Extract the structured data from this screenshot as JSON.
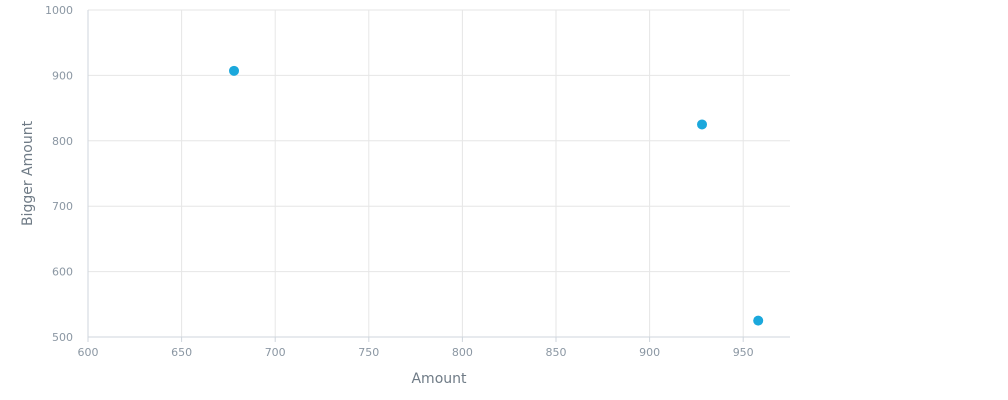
{
  "chart_data": {
    "type": "scatter",
    "title": "",
    "xlabel": "Amount",
    "ylabel": "Bigger Amount",
    "xlim": [
      600,
      975
    ],
    "ylim": [
      500,
      1000
    ],
    "x_ticks": [
      600,
      650,
      700,
      750,
      800,
      850,
      900,
      950
    ],
    "y_ticks": [
      500,
      600,
      700,
      800,
      900,
      1000
    ],
    "grid": true,
    "legend": "none",
    "point_color": "#1ba8dc",
    "series": [
      {
        "points": [
          {
            "x": 678,
            "y": 907
          },
          {
            "x": 928,
            "y": 825
          },
          {
            "x": 958,
            "y": 525
          }
        ]
      }
    ]
  }
}
